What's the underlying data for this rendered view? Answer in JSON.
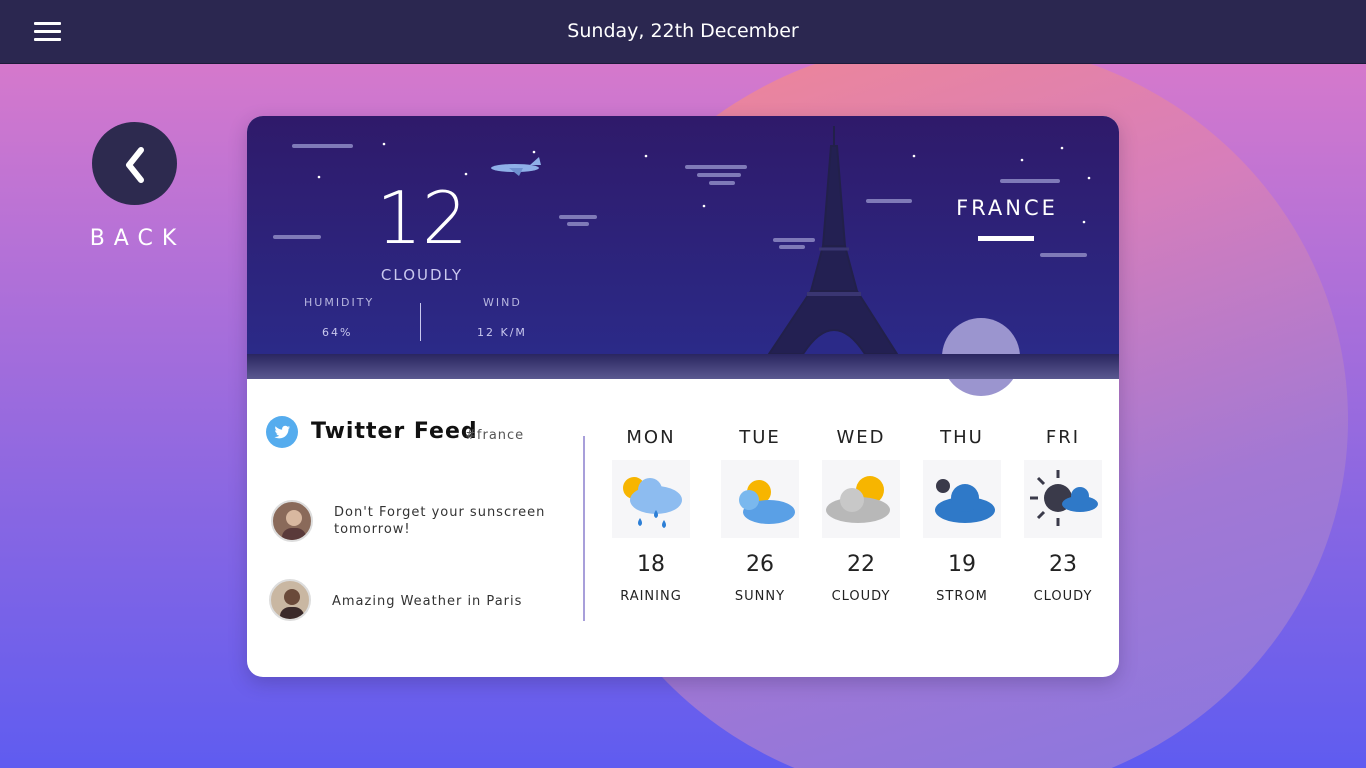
{
  "header": {
    "date": "Sunday, 22th December"
  },
  "nav": {
    "back_label": "BACK"
  },
  "current": {
    "temperature": "12",
    "condition": "CLOUDLY",
    "humidity_label": "HUMIDITY",
    "humidity_value": "64%",
    "wind_label": "WIND",
    "wind_value": "12 K/M",
    "country": "FRANCE"
  },
  "twitter": {
    "title": "Twitter Feed",
    "hashtag": "#france",
    "tweets": [
      {
        "text_line1": "Don't Forget your sunscreen",
        "text_line2": "tomorrow!"
      },
      {
        "text_line1": "Amazing Weather in Paris"
      }
    ]
  },
  "forecast": [
    {
      "day": "MON",
      "temp": "18",
      "condition": "RAINING",
      "icon": "sun-rain-icon"
    },
    {
      "day": "TUE",
      "temp": "26",
      "condition": "SUNNY",
      "icon": "sun-cloud-icon"
    },
    {
      "day": "WED",
      "temp": "22",
      "condition": "CLOUDY",
      "icon": "cloud-sun-icon"
    },
    {
      "day": "THU",
      "temp": "19",
      "condition": "STROM",
      "icon": "cloud-icon"
    },
    {
      "day": "FRI",
      "temp": "23",
      "condition": "CLOUDY",
      "icon": "night-cloud-icon"
    }
  ],
  "colors": {
    "topbar": "#2b2750",
    "accent": "#55acee",
    "hero": "#2b2a88"
  }
}
